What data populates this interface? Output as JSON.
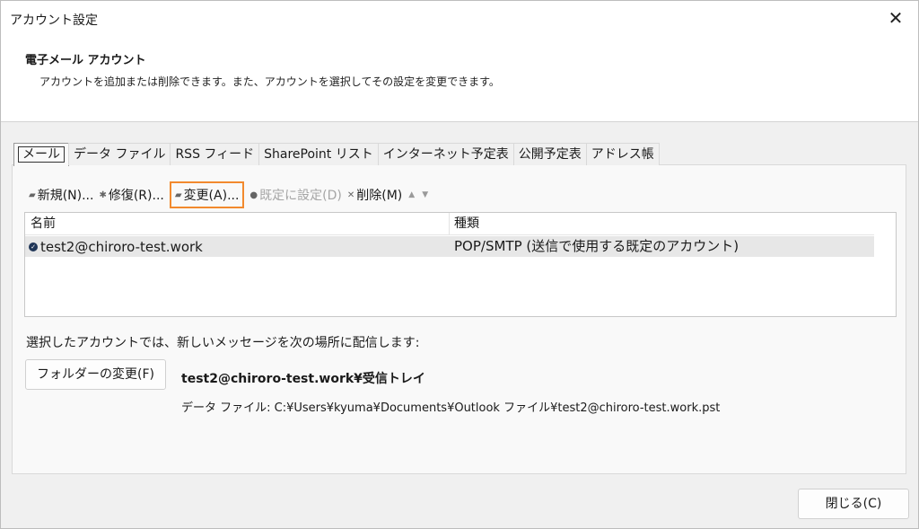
{
  "window": {
    "title": "アカウント設定",
    "close_glyph": "✕"
  },
  "header": {
    "title": "電子メール アカウント",
    "description": "アカウントを追加または削除できます。また、アカウントを選択してその設定を変更できます。"
  },
  "tabs": [
    {
      "label": "メール",
      "active": true
    },
    {
      "label": "データ ファイル"
    },
    {
      "label": "RSS フィード"
    },
    {
      "label": "SharePoint リスト"
    },
    {
      "label": "インターネット予定表"
    },
    {
      "label": "公開予定表"
    },
    {
      "label": "アドレス帳"
    }
  ],
  "toolbar": {
    "new_label": "新規(N)...",
    "repair_label": "修復(R)...",
    "change_label": "変更(A)...",
    "default_label": "既定に設定(D)",
    "delete_label": "削除(M)",
    "highlight_color": "#f28a2e"
  },
  "account_list": {
    "col_name": "名前",
    "col_type": "種類",
    "rows": [
      {
        "name": "test2@chiroro-test.work",
        "type": "POP/SMTP (送信で使用する既定のアカウント)"
      }
    ]
  },
  "delivery": {
    "label": "選択したアカウントでは、新しいメッセージを次の場所に配信します:",
    "folder_button": "フォルダーの変更(F)",
    "target": "test2@chiroro-test.work¥受信トレイ",
    "datafile": "データ ファイル: C:¥Users¥kyuma¥Documents¥Outlook ファイル¥test2@chiroro-test.work.pst"
  },
  "footer": {
    "close_button": "閉じる(C)"
  }
}
